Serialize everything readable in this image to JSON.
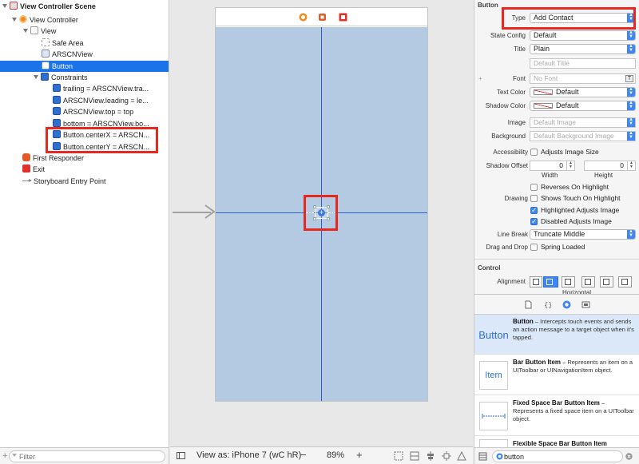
{
  "outline": {
    "items": [
      {
        "label": "View Controller Scene",
        "icon": "scene-icon"
      },
      {
        "label": "View Controller",
        "icon": "view-controller-icon"
      },
      {
        "label": "View",
        "icon": "view-icon"
      },
      {
        "label": "Safe Area",
        "icon": "safe-area-icon"
      },
      {
        "label": "ARSCNView",
        "icon": "scene-view-icon"
      },
      {
        "label": "Button",
        "icon": "button-icon"
      },
      {
        "label": "Constraints",
        "icon": "constraints-icon"
      },
      {
        "label": "trailing = ARSCNView.tra...",
        "icon": "constraint-icon"
      },
      {
        "label": "ARSCNView.leading = le...",
        "icon": "constraint-icon"
      },
      {
        "label": "ARSCNView.top = top",
        "icon": "constraint-icon"
      },
      {
        "label": "bottom = ARSCNView.bo...",
        "icon": "constraint-icon"
      },
      {
        "label": "Button.centerX = ARSCN...",
        "icon": "constraint-icon"
      },
      {
        "label": "Button.centerY = ARSCN...",
        "icon": "constraint-icon"
      },
      {
        "label": "First Responder",
        "icon": "first-responder-icon"
      },
      {
        "label": "Exit",
        "icon": "exit-icon"
      },
      {
        "label": "Storyboard Entry Point",
        "icon": "entry-arrow-icon"
      }
    ],
    "filter_placeholder": "Filter"
  },
  "canvas": {
    "view_as": "View as: iPhone 7 (wC hR)",
    "zoom_minus": "−",
    "zoom": "89%",
    "zoom_plus": "+"
  },
  "inspector": {
    "section_button": "Button",
    "type_label": "Type",
    "type_value": "Add Contact",
    "state_label": "State Config",
    "state_value": "Default",
    "title_label": "Title",
    "title_value": "Plain",
    "title_placeholder": "Default Title",
    "font_label": "Font",
    "font_placeholder": "No Font",
    "text_color_label": "Text Color",
    "text_color_value": "Default",
    "shadow_color_label": "Shadow Color",
    "shadow_color_value": "Default",
    "image_label": "Image",
    "image_placeholder": "Default Image",
    "background_label": "Background",
    "background_placeholder": "Default Background Image",
    "accessibility_label": "Accessibility",
    "adjusts_image_size": "Adjusts Image Size",
    "shadow_offset_label": "Shadow Offset",
    "shadow_w": "0",
    "shadow_h": "0",
    "width_label": "Width",
    "height_label": "Height",
    "reverses": "Reverses On Highlight",
    "drawing_label": "Drawing",
    "shows_touch": "Shows Touch On Highlight",
    "highlighted_adjusts": "Highlighted Adjusts Image",
    "disabled_adjusts": "Disabled Adjusts Image",
    "line_break_label": "Line Break",
    "line_break_value": "Truncate Middle",
    "drag_drop_label": "Drag and Drop",
    "spring_loaded": "Spring Loaded",
    "section_control": "Control",
    "alignment_label": "Alignment",
    "horizontal_label": "Horizontal"
  },
  "library": {
    "items": [
      {
        "thumb": "Button",
        "title": "Button",
        "desc": " – Intercepts touch events and sends an action message to a target object when it's tapped."
      },
      {
        "thumb": "Item",
        "title": "Bar Button Item",
        "desc": " – Represents an item on a UIToolbar or UINavigationItem object."
      },
      {
        "thumb": "",
        "title": "Fixed Space Bar Button Item",
        "desc": " – Represents a fixed space item on a UIToolbar object."
      },
      {
        "thumb": "",
        "title": "Flexible Space Bar Button Item",
        "desc": ""
      }
    ],
    "search_value": "button"
  }
}
